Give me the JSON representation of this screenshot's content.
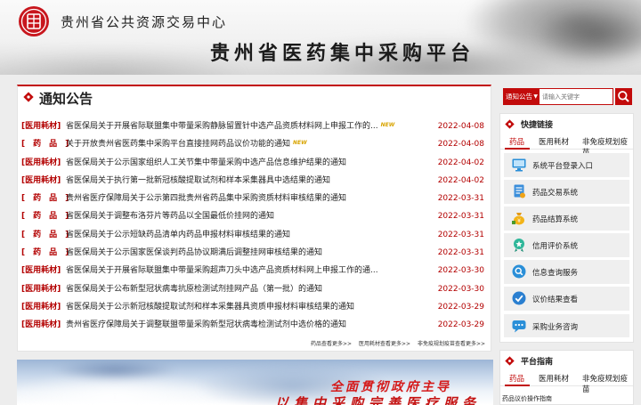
{
  "header": {
    "org_name": "贵州省公共资源交易中心",
    "platform_name": "贵州省医药集中采购平台"
  },
  "notice": {
    "title": "通知公告",
    "items": [
      {
        "category": "[医用耗材]",
        "text": "省医保局关于开展省际联盟集中带量采购静脉留置针中选产品资质材料网上申报工作的...",
        "new": true,
        "date": "2022-04-08"
      },
      {
        "category": "[　药　品　]",
        "text": "关于开放贵州省医药集中采购平台直接挂网药品议价功能的通知",
        "new": true,
        "date": "2022-04-08"
      },
      {
        "category": "[医用耗材]",
        "text": "省医保局关于公示国家组织人工关节集中带量采购中选产品信息维护结果的通知",
        "new": false,
        "date": "2022-04-02"
      },
      {
        "category": "[医用耗材]",
        "text": "省医保局关于执行第一批新冠核酸提取试剂和样本采集器具中选结果的通知",
        "new": false,
        "date": "2022-04-02"
      },
      {
        "category": "[　药　品　]",
        "text": "贵州省医疗保障局关于公示第四批贵州省药品集中采购资质材料审核结果的通知",
        "new": false,
        "date": "2022-03-31"
      },
      {
        "category": "[　药　品　]",
        "text": "省医保局关于调整布洛芬片等药品以全国最低价挂网的通知",
        "new": false,
        "date": "2022-03-31"
      },
      {
        "category": "[　药　品　]",
        "text": "省医保局关于公示短缺药品清单内药品申报材料审核结果的通知",
        "new": false,
        "date": "2022-03-31"
      },
      {
        "category": "[　药　品　]",
        "text": "省医保局关于公示国家医保谈判药品协议期满后调整挂网审核结果的通知",
        "new": false,
        "date": "2022-03-31"
      },
      {
        "category": "[医用耗材]",
        "text": "省医保局关于开展省际联盟集中带量采购超声刀头中选产品资质材料网上申报工作的通...",
        "new": false,
        "date": "2022-03-30"
      },
      {
        "category": "[医用耗材]",
        "text": "省医保局关于公布新型冠状病毒抗原检测试剂挂网产品（第一批）的通知",
        "new": false,
        "date": "2022-03-30"
      },
      {
        "category": "[医用耗材]",
        "text": "省医保局关于公示新冠核酸提取试剂和样本采集器具资质申报材料审核结果的通知",
        "new": false,
        "date": "2022-03-29"
      },
      {
        "category": "[医用耗材]",
        "text": "贵州省医疗保障局关于调整联盟带量采购新型冠状病毒检测试剂中选价格的通知",
        "new": false,
        "date": "2022-03-29"
      }
    ],
    "new_badge": "NEW",
    "more": [
      "药品查看更多>>",
      "医用耗材查看更多>>",
      "非免疫规划疫苗查看更多>>"
    ]
  },
  "banner": {
    "line1": "全面贯彻政府主导",
    "line2": "以集中采购完善医疗服务"
  },
  "search": {
    "category": "通知公告",
    "placeholder": "请输入关键字"
  },
  "quick_links": {
    "title": "快捷链接",
    "tabs": [
      "药品",
      "医用耗材",
      "非免疫规划疫苗"
    ],
    "items": [
      {
        "label": "系统平台登录入口",
        "icon": "monitor-icon"
      },
      {
        "label": "药品交易系统",
        "icon": "document-icon"
      },
      {
        "label": "药品结算系统",
        "icon": "money-bag-icon"
      },
      {
        "label": "信用评价系统",
        "icon": "badge-icon"
      },
      {
        "label": "信息查询服务",
        "icon": "search-icon"
      },
      {
        "label": "议价结果查看",
        "icon": "check-icon"
      },
      {
        "label": "采购业务咨询",
        "icon": "chat-icon"
      }
    ]
  },
  "guide": {
    "title": "平台指南",
    "tabs": [
      "药品",
      "医用耗材",
      "非免疫规划疫苗"
    ],
    "first_item": "药品议价操作指南"
  },
  "colors": {
    "accent": "#c20b0b",
    "date": "#b30000"
  }
}
